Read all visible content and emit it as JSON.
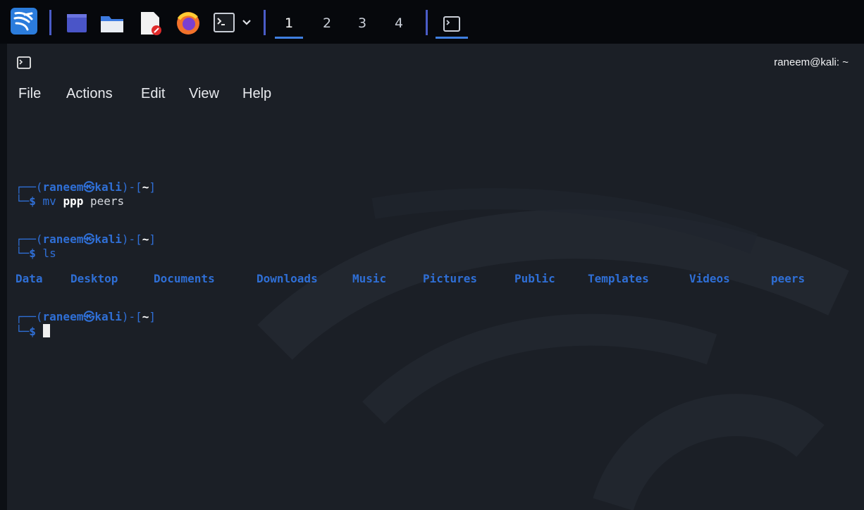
{
  "taskbar": {
    "workspaces": [
      "1",
      "2",
      "3",
      "4"
    ],
    "active_workspace": "1"
  },
  "window": {
    "title": "raneem@kali: ~",
    "menu": [
      "File",
      "Actions",
      "Edit",
      "View",
      "Help"
    ]
  },
  "terminal": {
    "prompt": {
      "open": "┌──(",
      "user": "raneem",
      "at": "㉿",
      "host": "kali",
      "mid": ")-[",
      "path": "~",
      "close": "]",
      "dollar_prefix": "└─",
      "dollar": "$"
    },
    "blocks": [
      {
        "cmd": "mv",
        "args_bold": "ppp",
        "args": " peers"
      },
      {
        "cmd": "ls"
      }
    ],
    "ls_output": [
      "Data",
      "Desktop",
      "Documents",
      "Downloads",
      "Music",
      "Pictures",
      "Public",
      "Templates",
      "Videos",
      "peers"
    ]
  },
  "colors": {
    "prompt_blue": "#2f6fd6",
    "terminal_bg": "#1b1f26",
    "taskbar_bg": "#06080c"
  }
}
